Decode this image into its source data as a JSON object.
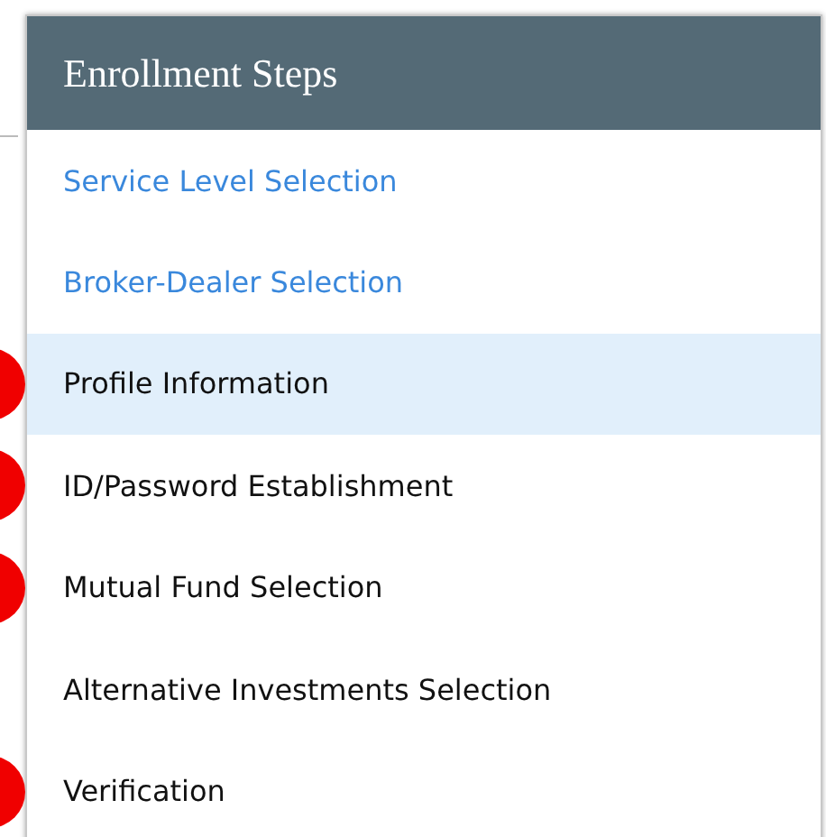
{
  "panel": {
    "title": "Enrollment Steps"
  },
  "steps": [
    {
      "label": "Service Level Selection",
      "kind": "link",
      "selected": false,
      "marker": false
    },
    {
      "label": "Broker-Dealer Selection",
      "kind": "link",
      "selected": false,
      "marker": false
    },
    {
      "label": "Profile Information",
      "kind": "plain",
      "selected": true,
      "marker": true
    },
    {
      "label": "ID/Password Establishment",
      "kind": "plain",
      "selected": false,
      "marker": true
    },
    {
      "label": "Mutual Fund Selection",
      "kind": "plain",
      "selected": false,
      "marker": true
    },
    {
      "label": "Alternative Investments Selection",
      "kind": "plain",
      "selected": false,
      "marker": false
    },
    {
      "label": "Verification",
      "kind": "plain",
      "selected": false,
      "marker": true
    }
  ]
}
